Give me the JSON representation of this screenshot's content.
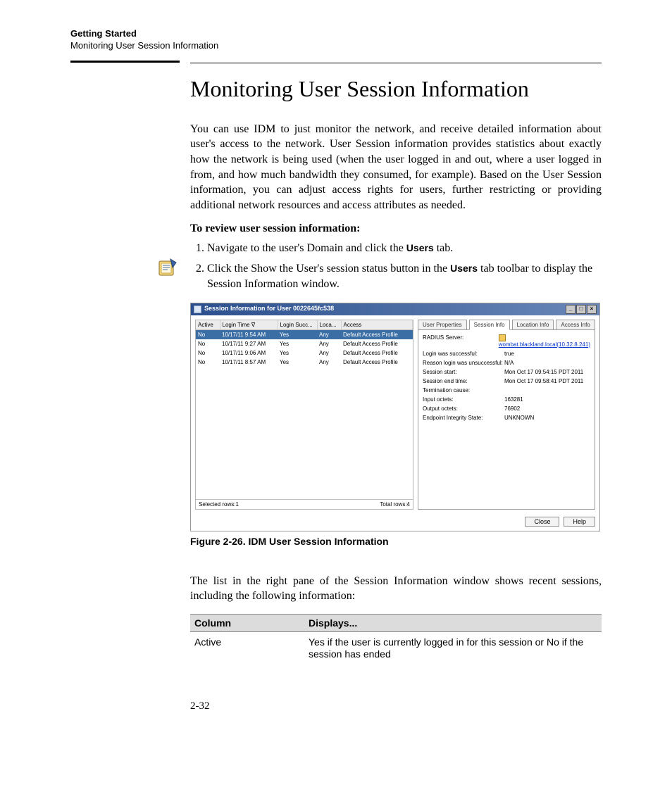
{
  "runningHead": {
    "line1": "Getting Started",
    "line2": "Monitoring User Session Information"
  },
  "heading": "Monitoring User Session Information",
  "intro": "You can use IDM to just monitor the network, and receive detailed information about user's access to the network. User Session information provides statistics about exactly how the network is being used (when the user logged in and out, where a user logged in from, and how much bandwidth they consumed, for example). Based on the User Session information, you can adjust access rights for users, further restricting or providing additional network resources and access attributes as needed.",
  "subhead": "To review user session information:",
  "step1_prefix": "Navigate to the user's Domain and click the ",
  "step1_bold": "Users",
  "step1_suffix": " tab.",
  "step2_prefix": "Click the Show the User's session status button in the ",
  "step2_bold": "Users",
  "step2_suffix": " tab toolbar to display the Session Information window.",
  "screenshot": {
    "title": "Session Information for User 0022645fc538",
    "columns": [
      "Active",
      "Login Time ∇",
      "Login Succ...",
      "Loca...",
      "Access"
    ],
    "rows": [
      {
        "active": "No",
        "time": "10/17/11 9:54 AM",
        "succ": "Yes",
        "loc": "Any",
        "access": "Default Access Profile"
      },
      {
        "active": "No",
        "time": "10/17/11 9:27 AM",
        "succ": "Yes",
        "loc": "Any",
        "access": "Default Access Profile"
      },
      {
        "active": "No",
        "time": "10/17/11 9:06 AM",
        "succ": "Yes",
        "loc": "Any",
        "access": "Default Access Profile"
      },
      {
        "active": "No",
        "time": "10/17/11 8:57 AM",
        "succ": "Yes",
        "loc": "Any",
        "access": "Default Access Profile"
      }
    ],
    "footer": {
      "left": "Selected rows:1",
      "right": "Total rows:4"
    },
    "tabs": [
      "User Properties",
      "Session Info",
      "Location Info",
      "Access Info"
    ],
    "tabs_active_index": 1,
    "details": {
      "RADIUS Server:": "wombat.blackland.local(10.32.8.241)",
      "Login was successful:": "true",
      "Reason login was unsuccessful:": "N/A",
      "Session start:": "Mon Oct 17 09:54:15 PDT 2011",
      "Session end time:": "Mon Oct 17 09:58:41 PDT 2011",
      "Termination cause:": "",
      "Input octets:": "163281",
      "Output octets:": "76902",
      "Endpoint Integrity State:": "UNKNOWN"
    },
    "buttons": {
      "close": "Close",
      "help": "Help"
    }
  },
  "figcap": "Figure 2-26. IDM User Session Information",
  "body2": "The list in the right pane of the Session Information window shows recent sessions, including the following information:",
  "coltable": {
    "headers": [
      "Column",
      "Displays..."
    ],
    "rows": [
      {
        "col": "Active",
        "disp": "Yes if the user is currently logged in for this session or No if the session has ended"
      }
    ]
  },
  "pagenum": "2-32"
}
